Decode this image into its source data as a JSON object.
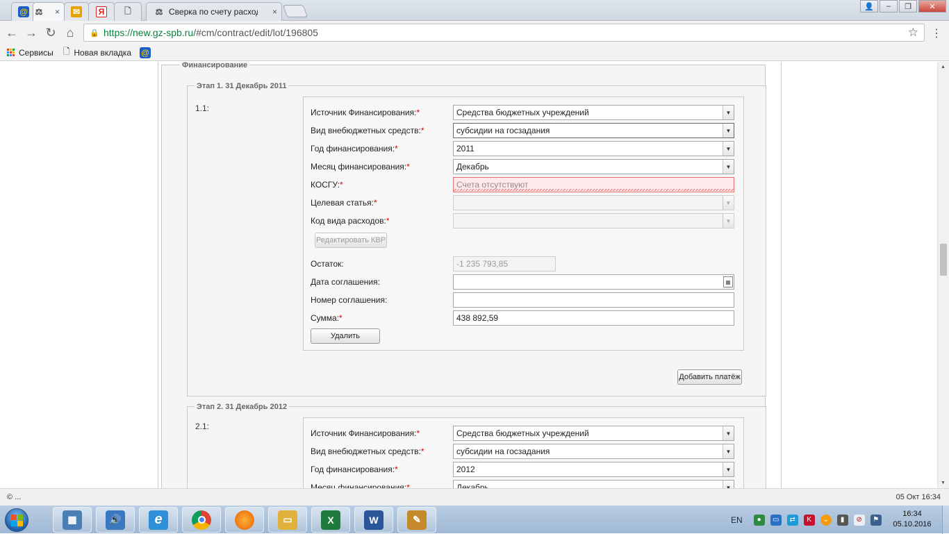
{
  "browser": {
    "tabs": [
      {
        "name": "tab-mailru",
        "icon": "mailru-at-icon",
        "icon_glyph": "@",
        "color": "#f5a623"
      },
      {
        "name": "tab-gz-spb",
        "icon": "gavel-icon",
        "icon_glyph": "⚖",
        "color": "#555555",
        "active": true
      },
      {
        "name": "tab-mail",
        "icon": "envelope-icon",
        "icon_glyph": "✉",
        "color": "#e8a200"
      },
      {
        "name": "tab-yandex",
        "icon": "yandex-icon",
        "icon_glyph": "Я",
        "color": "#e02020"
      },
      {
        "name": "tab-blank",
        "icon": "page-icon",
        "icon_glyph": "🗋",
        "color": "#666666"
      },
      {
        "name": "tab-sverka",
        "icon": "gavel-icon",
        "icon_glyph": "⚖",
        "color": "#555555",
        "title": "Сверка по счету расход"
      }
    ],
    "close_glyph": "×",
    "window_controls": {
      "user": "👤",
      "minimize": "–",
      "restore": "❐",
      "close": "✕"
    },
    "url_host": "https://new.gz-spb.ru",
    "url_rest": "/#cm/contract/edit/lot/196805",
    "bookmarks": [
      {
        "name": "bookmark-services",
        "label": "Сервисы"
      },
      {
        "name": "bookmark-new-tab",
        "label": "Новая вкладка"
      },
      {
        "name": "bookmark-mailru",
        "label": ""
      }
    ],
    "status_left": "© ...",
    "status_right": "05 Окт 16:34"
  },
  "page": {
    "section_title": "Финансирование",
    "stages": [
      {
        "legend": "Этап 1. 31 Декабрь 2011",
        "payment_num": "1.1:",
        "fields": {
          "source_label": "Источник Финансирования:",
          "source_value": "Средства бюджетных учреждений",
          "offbudget_label": "Вид внебюджетных средств:",
          "offbudget_value": "субсидии на госзадания",
          "year_label": "Год финансирования:",
          "year_value": "2011",
          "month_label": "Месяц финансирования:",
          "month_value": "Декабрь",
          "kosgu_label": "КОСГУ:",
          "kosgu_value": "Счета отсутствуют",
          "target_label": "Целевая статья:",
          "target_value": "",
          "expense_label": "Код вида расходов:",
          "expense_value": "",
          "edit_kvr_label": "Редактировать КВР",
          "balance_label": "Остаток:",
          "balance_value": "-1 235 793,85",
          "agreement_date_label": "Дата соглашения:",
          "agreement_date_value": "",
          "agreement_num_label": "Номер соглашения:",
          "agreement_num_value": "",
          "sum_label": "Сумма:",
          "sum_value": "438 892,59",
          "delete_label": "Удалить"
        },
        "add_payment_label": "Добавить платёж"
      },
      {
        "legend": "Этап 2. 31 Декабрь 2012",
        "payment_num": "2.1:",
        "fields": {
          "source_label": "Источник Финансирования:",
          "source_value": "Средства бюджетных учреждений",
          "offbudget_label": "Вид внебюджетных средств:",
          "offbudget_value": "субсидии на госзадания",
          "year_label": "Год финансирования:",
          "year_value": "2012",
          "month_label": "Месяц финансирования:",
          "month_value": "Декабрь"
        }
      }
    ],
    "required_mark": "*"
  },
  "taskbar": {
    "apps": [
      {
        "name": "taskbar-calculator",
        "icon": "calculator-icon",
        "glyph": "▦",
        "color": "#4a7fb5"
      },
      {
        "name": "taskbar-volume",
        "icon": "speaker-icon",
        "glyph": "🔊",
        "color": "#3a78c2"
      },
      {
        "name": "taskbar-ie",
        "icon": "internet-explorer-icon",
        "glyph": "e",
        "color": "#2f8fd8"
      },
      {
        "name": "taskbar-chrome",
        "icon": "chrome-icon",
        "glyph": "◉",
        "color": "#db4437"
      },
      {
        "name": "taskbar-firefox",
        "icon": "firefox-icon",
        "glyph": "◍",
        "color": "#e66000"
      },
      {
        "name": "taskbar-explorer",
        "icon": "folder-icon",
        "glyph": "▭",
        "color": "#e0b23c"
      },
      {
        "name": "taskbar-excel",
        "icon": "excel-icon",
        "glyph": "X",
        "color": "#1f7a3d"
      },
      {
        "name": "taskbar-word",
        "icon": "word-icon",
        "glyph": "W",
        "color": "#2b579a"
      },
      {
        "name": "taskbar-paint",
        "icon": "paint-icon",
        "glyph": "✎",
        "color": "#c58a2a"
      }
    ],
    "language": "EN",
    "time": "16:34",
    "date": "05.10.2016"
  }
}
